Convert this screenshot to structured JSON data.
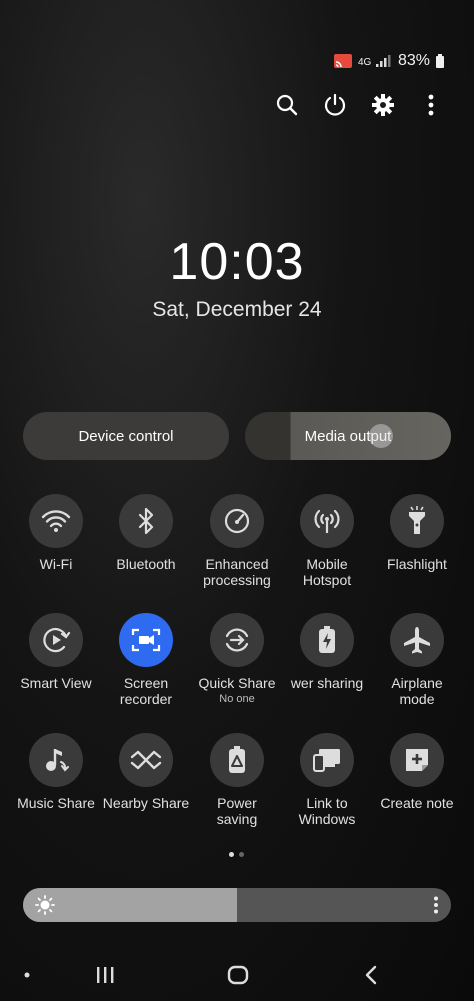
{
  "status": {
    "battery": "83%"
  },
  "clock": {
    "time": "10:03",
    "date": "Sat, December 24"
  },
  "top_controls": {
    "device_control": "Device control",
    "media_output": "Media output"
  },
  "tiles": [
    {
      "id": "wifi",
      "label": "Wi-Fi",
      "icon": "wifi-icon",
      "active": false
    },
    {
      "id": "bluetooth",
      "label": "Bluetooth",
      "icon": "bluetooth-icon",
      "active": false
    },
    {
      "id": "enhanced",
      "label": "Enhanced\nprocessing",
      "icon": "gauge-icon",
      "active": false
    },
    {
      "id": "hotspot",
      "label": "Mobile\nHotspot",
      "icon": "hotspot-icon",
      "active": false
    },
    {
      "id": "flashlight",
      "label": "Flashlight",
      "icon": "flashlight-icon",
      "active": false
    },
    {
      "id": "smartview",
      "label": "Smart View",
      "icon": "smart-view-icon",
      "active": false
    },
    {
      "id": "screenrec",
      "label": "Screen\nrecorder",
      "icon": "screen-recorder-icon",
      "active": true
    },
    {
      "id": "quickshare",
      "label": "Quick Share",
      "sub": "No one",
      "icon": "quick-share-icon",
      "active": false
    },
    {
      "id": "powershare",
      "label": "wer sharing",
      "icon": "power-sharing-icon",
      "active": false
    },
    {
      "id": "airplane",
      "label": "Airplane\nmode",
      "icon": "airplane-icon",
      "active": false
    },
    {
      "id": "musicshare",
      "label": "Music Share",
      "icon": "music-share-icon",
      "active": false
    },
    {
      "id": "nearbyshare",
      "label": "Nearby Share",
      "icon": "nearby-share-icon",
      "active": false
    },
    {
      "id": "powersaving",
      "label": "Power\nsaving",
      "icon": "power-saving-icon",
      "active": false
    },
    {
      "id": "linkwindows",
      "label": "Link to\nWindows",
      "icon": "link-windows-icon",
      "active": false
    },
    {
      "id": "createnote",
      "label": "Create note",
      "icon": "create-note-icon",
      "active": false
    }
  ],
  "brightness": {
    "level": 0.5
  },
  "colors": {
    "accent": "#2f6bf0",
    "tile_bg": "#3a3a3a"
  }
}
